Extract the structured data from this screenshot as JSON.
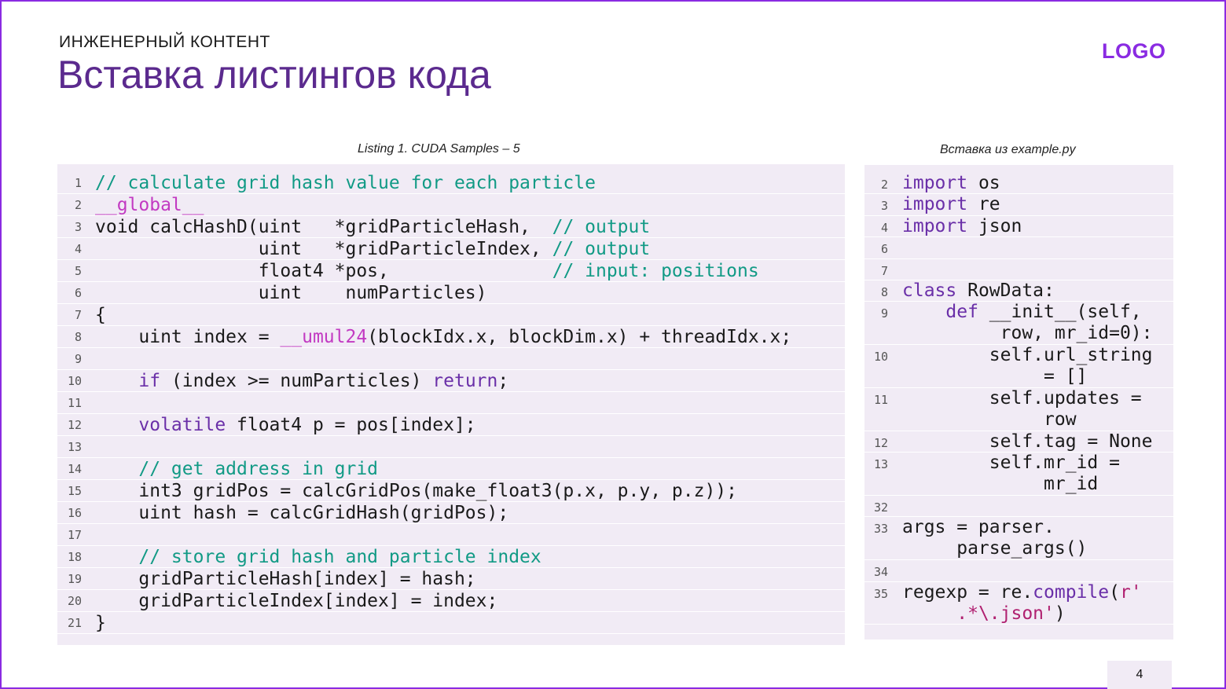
{
  "header": {
    "eyebrow": "ИНЖЕНЕРНЫЙ КОНТЕНТ",
    "title": "Вставка листингов кода",
    "logo": "LOGO"
  },
  "listing_left": {
    "caption": "Listing 1. CUDA Samples – 5",
    "lines": [
      {
        "n": "1",
        "parts": [
          {
            "t": "// calculate grid hash value for each particle",
            "c": "cmt"
          }
        ]
      },
      {
        "n": "2",
        "parts": [
          {
            "t": "__global__",
            "c": "mac"
          }
        ]
      },
      {
        "n": "3",
        "parts": [
          {
            "t": "void calcHashD(uint   *gridParticleHash,  ",
            "c": ""
          },
          {
            "t": "// output",
            "c": "cmt"
          }
        ]
      },
      {
        "n": "4",
        "parts": [
          {
            "t": "               uint   *gridParticleIndex, ",
            "c": ""
          },
          {
            "t": "// output",
            "c": "cmt"
          }
        ]
      },
      {
        "n": "5",
        "parts": [
          {
            "t": "               float4 *pos,               ",
            "c": ""
          },
          {
            "t": "// input: positions",
            "c": "cmt"
          }
        ]
      },
      {
        "n": "6",
        "parts": [
          {
            "t": "               uint    numParticles)",
            "c": ""
          }
        ]
      },
      {
        "n": "7",
        "parts": [
          {
            "t": "{",
            "c": ""
          }
        ]
      },
      {
        "n": "8",
        "parts": [
          {
            "t": "    uint index = ",
            "c": ""
          },
          {
            "t": "__umul24",
            "c": "mac"
          },
          {
            "t": "(blockIdx.x, blockDim.x) + threadIdx.x;",
            "c": ""
          }
        ]
      },
      {
        "n": "9",
        "parts": [
          {
            "t": "",
            "c": ""
          }
        ]
      },
      {
        "n": "10",
        "parts": [
          {
            "t": "    ",
            "c": ""
          },
          {
            "t": "if",
            "c": "kw"
          },
          {
            "t": " (index >= numParticles) ",
            "c": ""
          },
          {
            "t": "return",
            "c": "kw"
          },
          {
            "t": ";",
            "c": ""
          }
        ]
      },
      {
        "n": "11",
        "parts": [
          {
            "t": "",
            "c": ""
          }
        ]
      },
      {
        "n": "12",
        "parts": [
          {
            "t": "    ",
            "c": ""
          },
          {
            "t": "volatile",
            "c": "kw"
          },
          {
            "t": " float4 p = pos[index];",
            "c": ""
          }
        ]
      },
      {
        "n": "13",
        "parts": [
          {
            "t": "",
            "c": ""
          }
        ]
      },
      {
        "n": "14",
        "parts": [
          {
            "t": "    ",
            "c": ""
          },
          {
            "t": "// get address in grid",
            "c": "cmt"
          }
        ]
      },
      {
        "n": "15",
        "parts": [
          {
            "t": "    int3 gridPos = calcGridPos(make_float3(p.x, p.y, p.z));",
            "c": ""
          }
        ]
      },
      {
        "n": "16",
        "parts": [
          {
            "t": "    uint hash = calcGridHash(gridPos);",
            "c": ""
          }
        ]
      },
      {
        "n": "17",
        "parts": [
          {
            "t": "",
            "c": ""
          }
        ]
      },
      {
        "n": "18",
        "parts": [
          {
            "t": "    ",
            "c": ""
          },
          {
            "t": "// store grid hash and particle index",
            "c": "cmt"
          }
        ]
      },
      {
        "n": "19",
        "parts": [
          {
            "t": "    gridParticleHash[index] = hash;",
            "c": ""
          }
        ]
      },
      {
        "n": "20",
        "parts": [
          {
            "t": "    gridParticleIndex[index] = index;",
            "c": ""
          }
        ]
      },
      {
        "n": "21",
        "parts": [
          {
            "t": "}",
            "c": ""
          }
        ]
      }
    ]
  },
  "listing_right": {
    "caption": "Вставка из example.py",
    "lines": [
      {
        "n": "2",
        "rows": [
          [
            {
              "t": "import",
              "c": "kw"
            },
            {
              "t": " os",
              "c": ""
            }
          ]
        ]
      },
      {
        "n": "3",
        "rows": [
          [
            {
              "t": "import",
              "c": "kw"
            },
            {
              "t": " re",
              "c": ""
            }
          ]
        ]
      },
      {
        "n": "4",
        "rows": [
          [
            {
              "t": "import",
              "c": "kw"
            },
            {
              "t": " json",
              "c": ""
            }
          ]
        ]
      },
      {
        "n": "6",
        "rows": [
          [
            {
              "t": "",
              "c": ""
            }
          ]
        ]
      },
      {
        "n": "7",
        "rows": [
          [
            {
              "t": "",
              "c": ""
            }
          ]
        ]
      },
      {
        "n": "8",
        "rows": [
          [
            {
              "t": "class",
              "c": "kw"
            },
            {
              "t": " RowData:",
              "c": ""
            }
          ]
        ]
      },
      {
        "n": "9",
        "rows": [
          [
            {
              "t": "    ",
              "c": ""
            },
            {
              "t": "def",
              "c": "kw"
            },
            {
              "t": " __init__(self,",
              "c": ""
            }
          ],
          [
            {
              "t": "         row, mr_id=0):",
              "c": ""
            }
          ]
        ]
      },
      {
        "n": "10",
        "rows": [
          [
            {
              "t": "        self.url_string",
              "c": ""
            }
          ],
          [
            {
              "t": "             = []",
              "c": ""
            }
          ]
        ]
      },
      {
        "n": "11",
        "rows": [
          [
            {
              "t": "        self.updates =",
              "c": ""
            }
          ],
          [
            {
              "t": "             row",
              "c": ""
            }
          ]
        ]
      },
      {
        "n": "12",
        "rows": [
          [
            {
              "t": "        self.tag = None",
              "c": ""
            }
          ]
        ]
      },
      {
        "n": "13",
        "rows": [
          [
            {
              "t": "        self.mr_id =",
              "c": ""
            }
          ],
          [
            {
              "t": "             mr_id",
              "c": ""
            }
          ]
        ]
      },
      {
        "n": "32",
        "rows": [
          [
            {
              "t": "",
              "c": ""
            }
          ]
        ]
      },
      {
        "n": "33",
        "rows": [
          [
            {
              "t": "args = parser.",
              "c": ""
            }
          ],
          [
            {
              "t": "     parse_args()",
              "c": ""
            }
          ]
        ]
      },
      {
        "n": "34",
        "rows": [
          [
            {
              "t": "",
              "c": ""
            }
          ]
        ]
      },
      {
        "n": "35",
        "rows": [
          [
            {
              "t": "regexp = re.",
              "c": ""
            },
            {
              "t": "compile",
              "c": "fn"
            },
            {
              "t": "(",
              "c": ""
            },
            {
              "t": "r'",
              "c": "str"
            }
          ],
          [
            {
              "t": "     ",
              "c": ""
            },
            {
              "t": ".*\\.json'",
              "c": "str"
            },
            {
              "t": ")",
              "c": ""
            }
          ]
        ]
      }
    ]
  },
  "footer": {
    "page_number": "4"
  },
  "colors": {
    "accent": "#5b2a8e",
    "logo": "#8a2be2",
    "comment": "#119a85",
    "keyword": "#6a2fa8",
    "macro": "#c23ac2",
    "code_background": "#f1ebf5"
  }
}
